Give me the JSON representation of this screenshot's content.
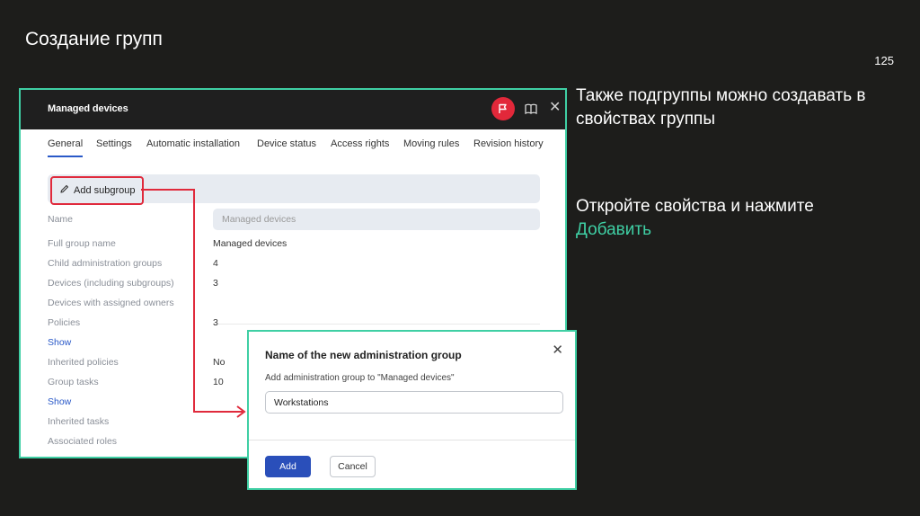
{
  "slide": {
    "title": "Создание групп",
    "page_number": "125",
    "note1": "Также подгруппы можно создавать в свойствах группы",
    "note2_line1": "Откройте свойства и нажмите",
    "note2_accent": "Добавить",
    "accent_color": "#3fcfa4"
  },
  "window": {
    "title": "Managed devices",
    "icons": [
      "flag-icon",
      "book-icon",
      "close-icon"
    ],
    "close_glyph": "✕",
    "tabs": [
      {
        "label": "General",
        "active": true
      },
      {
        "label": "Settings"
      },
      {
        "label": "Automatic installation"
      },
      {
        "label": "Device status"
      },
      {
        "label": "Access rights"
      },
      {
        "label": "Moving rules"
      },
      {
        "label": "Revision history"
      }
    ],
    "add_subgroup_label": "Add subgroup",
    "name_label": "Name",
    "name_value": "Managed devices",
    "properties": [
      {
        "label": "Full group name",
        "value": "Managed devices"
      },
      {
        "label": "Child administration groups",
        "value": "4"
      },
      {
        "label": "Devices (including subgroups)",
        "value": "3"
      },
      {
        "label": "Devices with assigned owners",
        "value": ""
      },
      {
        "label": "Policies",
        "value": "3"
      },
      {
        "label": "Show",
        "value": "",
        "link": true
      },
      {
        "label": "Inherited policies",
        "value": "No"
      },
      {
        "label": "Group tasks",
        "value": "10"
      },
      {
        "label": "Show",
        "value": "",
        "link": true
      },
      {
        "label": "Inherited tasks",
        "value": ""
      },
      {
        "label": "Associated roles",
        "value": ""
      }
    ]
  },
  "dialog": {
    "title": "Name of the new administration group",
    "close_glyph": "✕",
    "subtitle": "Add administration group to \"Managed devices\"",
    "input_value": "Workstations",
    "add_label": "Add",
    "cancel_label": "Cancel"
  }
}
